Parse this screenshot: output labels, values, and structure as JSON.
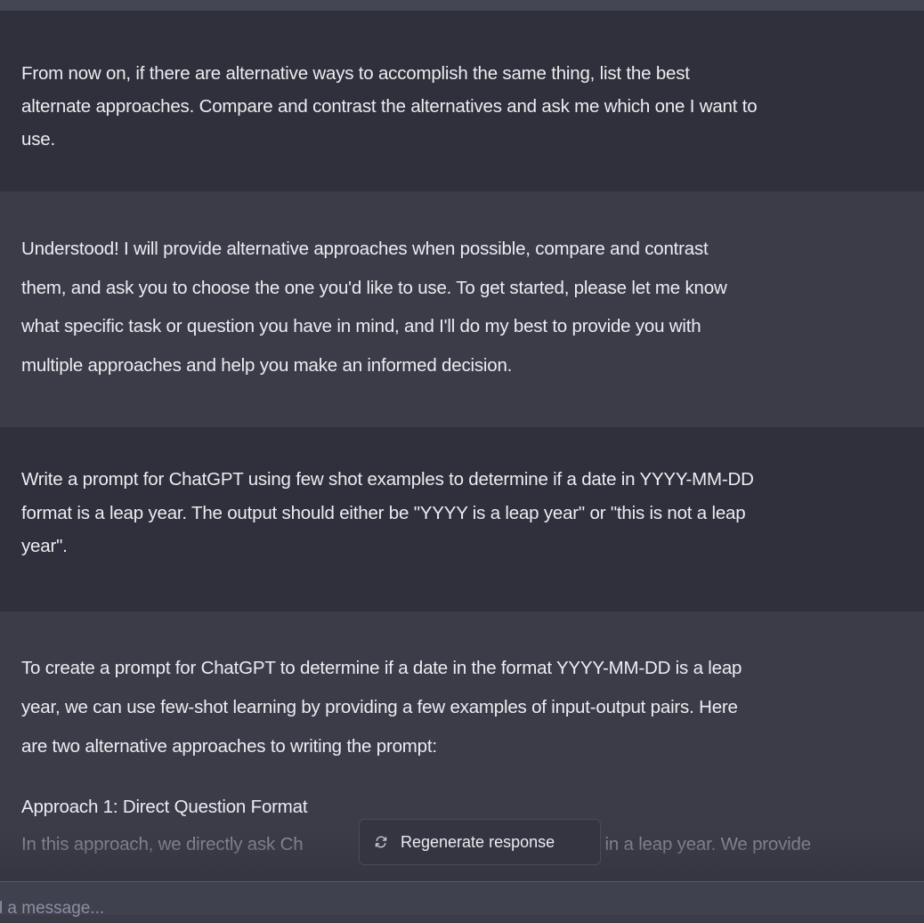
{
  "conversation": {
    "m1": {
      "role": "user",
      "lines": [
        "From now on, if there are alternative ways to accomplish the same thing, list the best",
        "alternate approaches. Compare and contrast the alternatives and ask me which one I want to",
        "use."
      ]
    },
    "m2": {
      "role": "assistant",
      "lines": [
        "Understood! I will provide alternative approaches when possible, compare and contrast",
        "them, and ask you to choose the one you'd like to use. To get started, please let me know",
        "what specific task or question you have in mind, and I'll do my best to provide you with",
        "multiple approaches and help you make an informed decision."
      ]
    },
    "m3": {
      "role": "user",
      "lines": [
        "Write a prompt for ChatGPT using few shot examples to determine if a date in YYYY-MM-DD",
        "format is a leap year. The output should either be \"YYYY is a leap year\" or \"this is not a leap",
        "year\"."
      ]
    },
    "m4": {
      "role": "assistant",
      "lines": [
        "To create a prompt for ChatGPT to determine if a date in the format YYYY-MM-DD is a leap",
        "year, we can use few-shot learning by providing a few examples of input-output pairs. Here",
        "are two alternative approaches to writing the prompt:"
      ],
      "approach_title": "Approach 1: Direct Question Format",
      "approach_body_partial": "In this approach, we directly ask Ch                                                    ate is in a leap year. We provide"
    }
  },
  "controls": {
    "regenerate_label": "Regenerate response",
    "regenerate_icon": "refresh-icon",
    "composer_placeholder": "nd a message..."
  },
  "colors": {
    "user_bg": "#2f303b",
    "assistant_bg": "#3b3c48",
    "text": "#ececf1"
  }
}
